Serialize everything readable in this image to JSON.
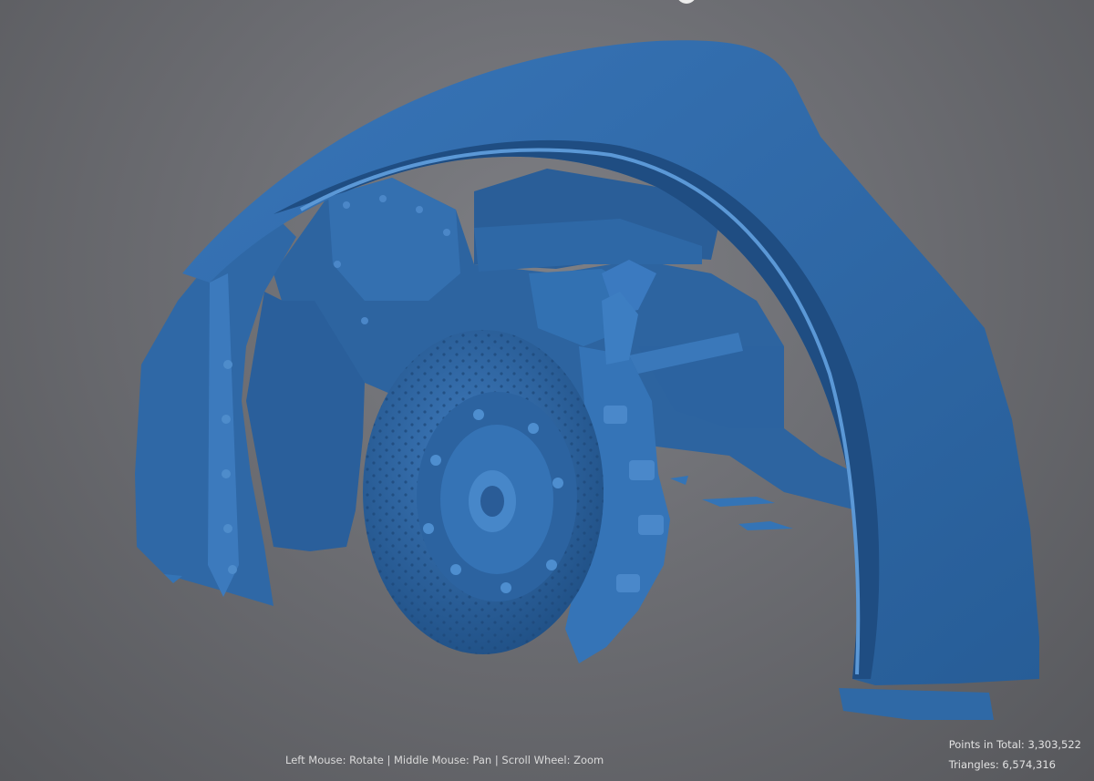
{
  "viewer": {
    "mesh_color": "#2f69a6",
    "background_color": "#6f7075",
    "navigation_hint": "Left Mouse: Rotate | Middle Mouse: Pan | Scroll Wheel: Zoom"
  },
  "stats": {
    "points_label": "Points in Total:",
    "points_value": "3,303,522",
    "triangles_label": "Triangles:",
    "triangles_value": "6,574,316"
  }
}
